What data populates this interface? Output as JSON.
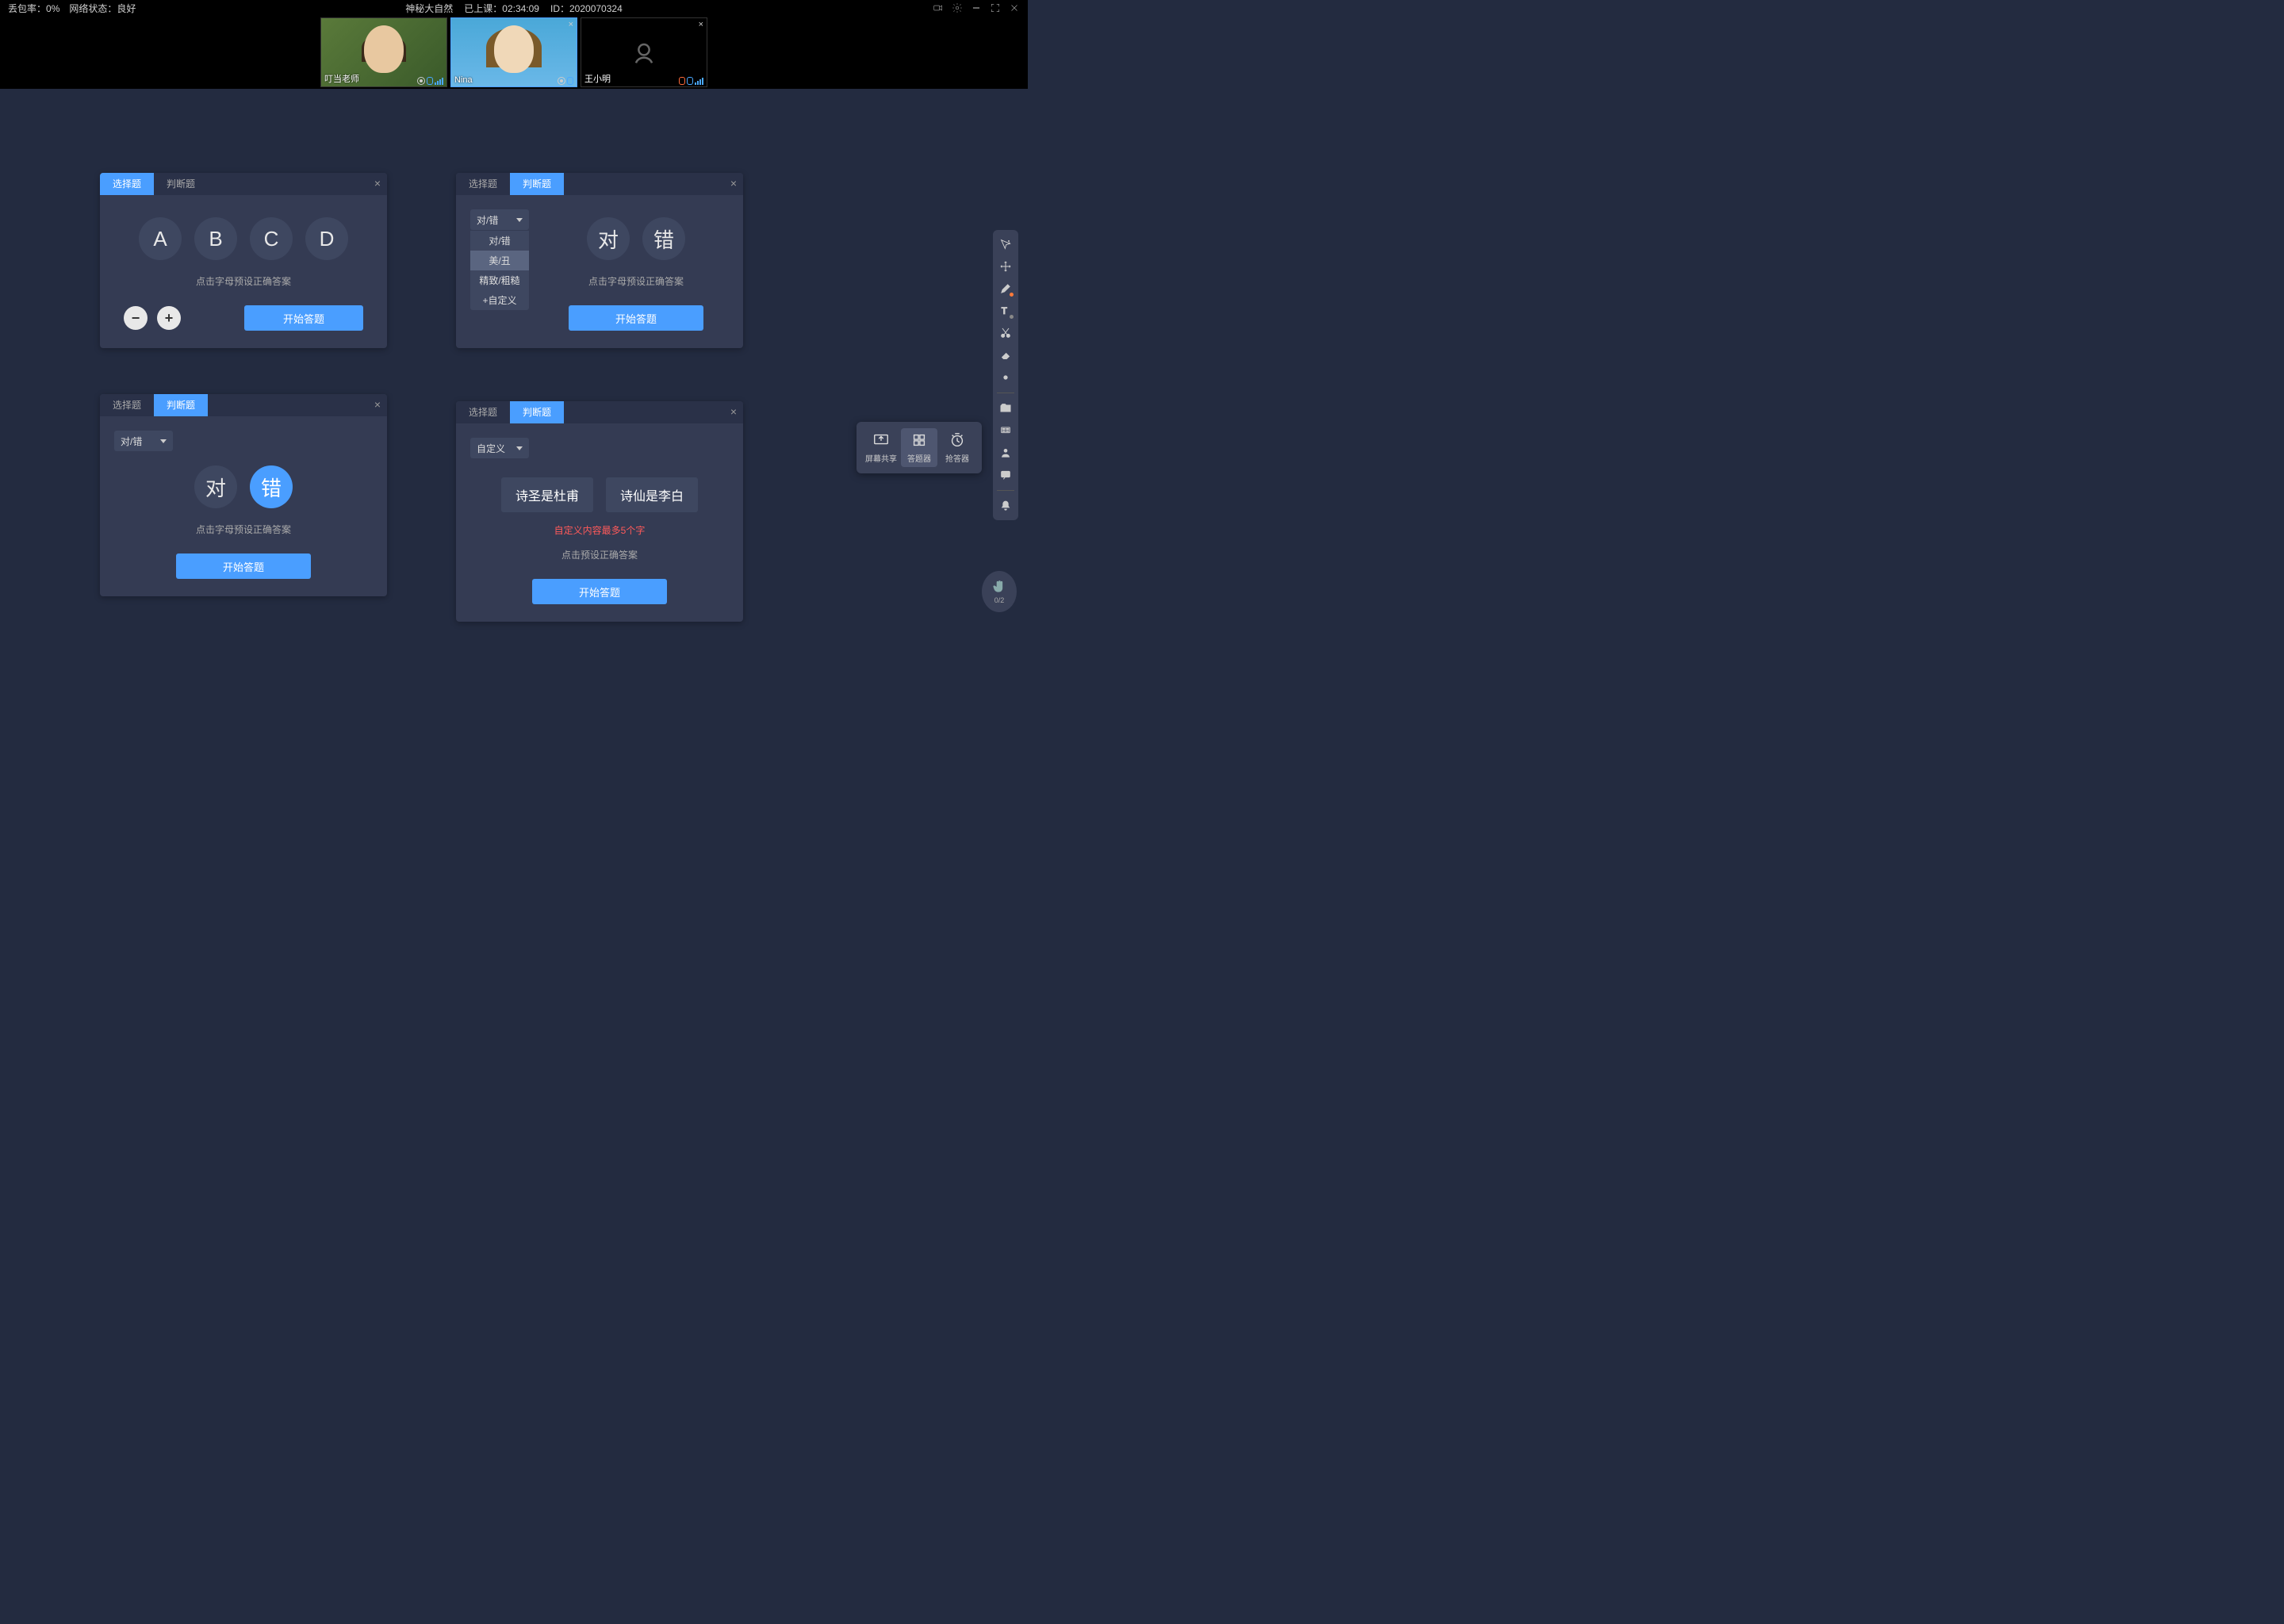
{
  "topbar": {
    "packet_loss_label": "丢包率：",
    "packet_loss_value": "0%",
    "network_label": "网络状态：",
    "network_value": "良好",
    "title": "神秘大自然",
    "duration_label": "已上课：",
    "duration_value": "02:34:09",
    "id_label": "ID：",
    "id_value": "2020070324"
  },
  "participants": [
    {
      "name": "叮当老师",
      "type": "teacher"
    },
    {
      "name": "Nina",
      "type": "student"
    },
    {
      "name": "王小明",
      "type": "camera_off"
    }
  ],
  "panel1": {
    "tab1": "选择题",
    "tab2": "判断题",
    "options": [
      "A",
      "B",
      "C",
      "D"
    ],
    "hint": "点击字母预设正确答案",
    "start": "开始答题"
  },
  "panel2": {
    "tab1": "选择题",
    "tab2": "判断题",
    "dd_label": "对/错",
    "dd_items": [
      "对/错",
      "美/丑",
      "精致/粗糙",
      "+自定义"
    ],
    "opt1": "对",
    "opt2": "错",
    "hint": "点击字母预设正确答案",
    "start": "开始答题"
  },
  "panel3": {
    "tab1": "选择题",
    "tab2": "判断题",
    "dd_label": "对/错",
    "opt1": "对",
    "opt2": "错",
    "hint": "点击字母预设正确答案",
    "start": "开始答题"
  },
  "panel4": {
    "tab1": "选择题",
    "tab2": "判断题",
    "dd_label": "自定义",
    "opt1": "诗圣是杜甫",
    "opt2": "诗仙是李白",
    "error": "自定义内容最多5个字",
    "hint": "点击预设正确答案",
    "start": "开始答题"
  },
  "popup": {
    "share": "屏幕共享",
    "quiz": "答题器",
    "buzzer": "抢答器"
  },
  "hand": {
    "count": "0/2"
  }
}
